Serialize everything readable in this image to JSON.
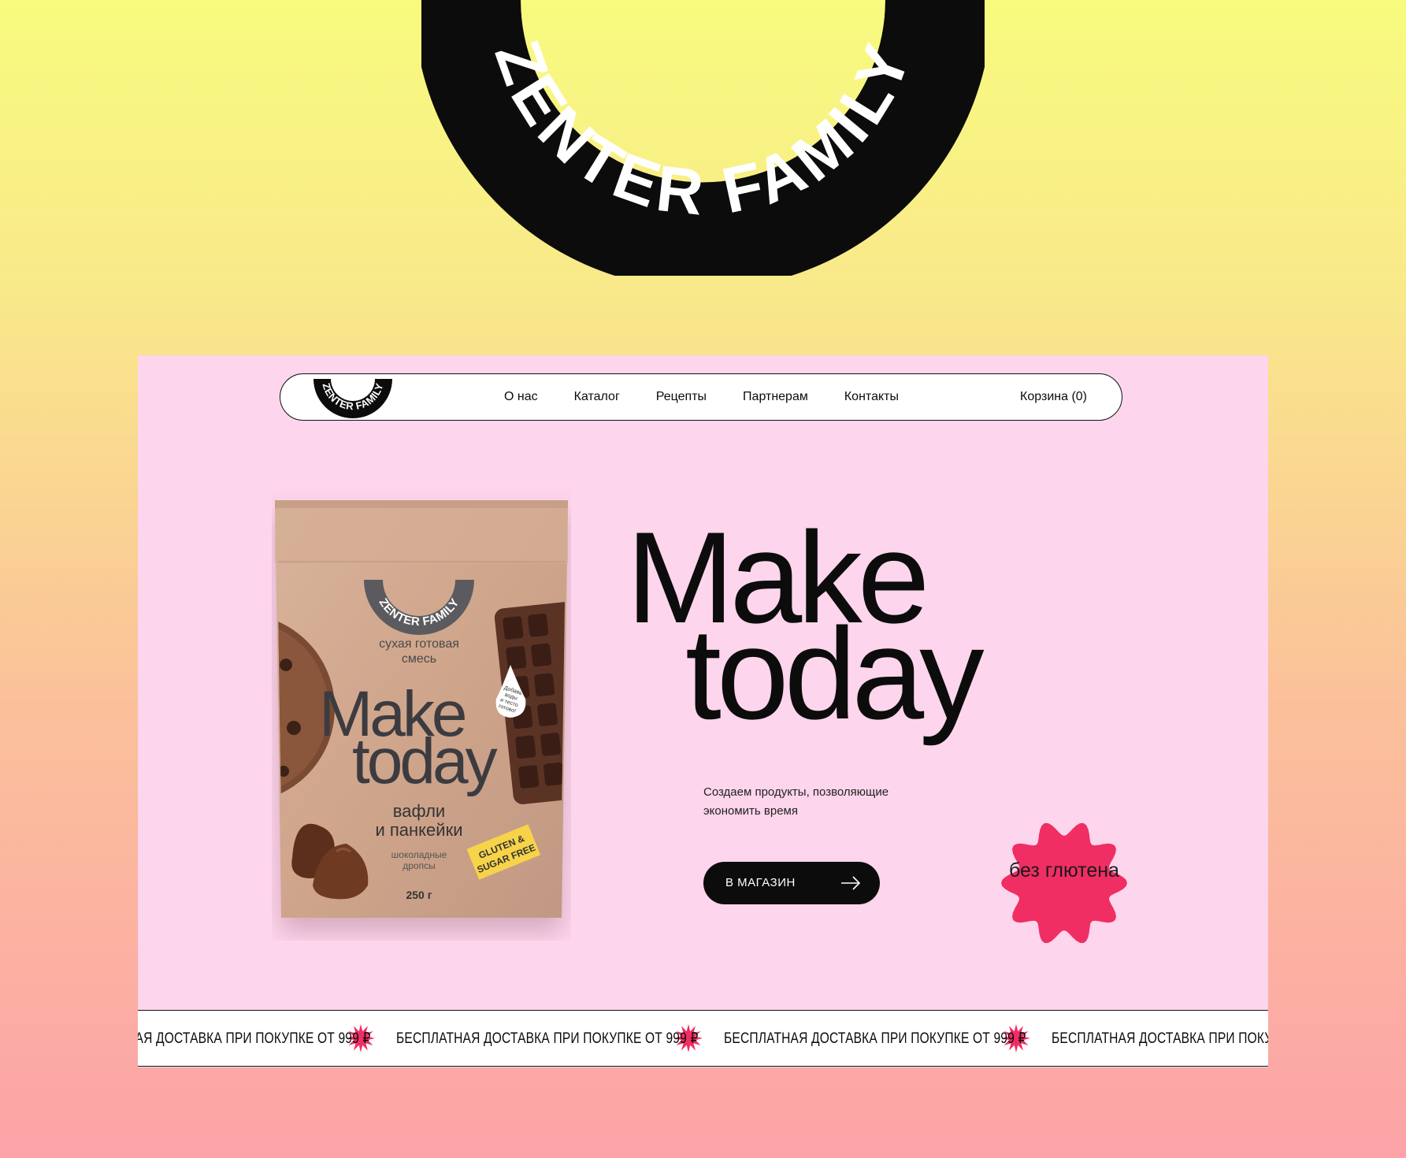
{
  "brand": {
    "logo_text": "ZENTER FAMILY"
  },
  "nav": {
    "items": [
      "О нас",
      "Каталог",
      "Рецепты",
      "Партнерам",
      "Контакты"
    ],
    "cart": "Корзина (0)"
  },
  "product": {
    "brand": "ZENTER FAMILY",
    "category": [
      "сухая готовая",
      "смесь"
    ],
    "title_line1": "Make",
    "title_line2": "today",
    "name": [
      "вафли",
      "и панкейки"
    ],
    "extra": [
      "шоколадные",
      "дропсы"
    ],
    "sticker": [
      "GLUTEN &",
      "SUGAR FREE"
    ],
    "drop_note": [
      "Добавь",
      "воды",
      "и тесто",
      "готово!"
    ],
    "weight": "250 г"
  },
  "hero": {
    "title_line1": "Make",
    "title_line2": "today",
    "subtitle": "Создаем продукты, позволяющие экономить время",
    "button_label": "В МАГАЗИН",
    "badge": "без глютена"
  },
  "ticker": {
    "text": "БЕСПЛАТНАЯ ДОСТАВКА ПРИ ПОКУПКЕ ОТ 999 ₽"
  },
  "colors": {
    "accent": "#f02e64",
    "site_bg": "#fdd5ec",
    "dark": "#0c0c0c"
  },
  "icons": {
    "button": "arrow-right-icon",
    "ticker": "star-burst-icon"
  }
}
